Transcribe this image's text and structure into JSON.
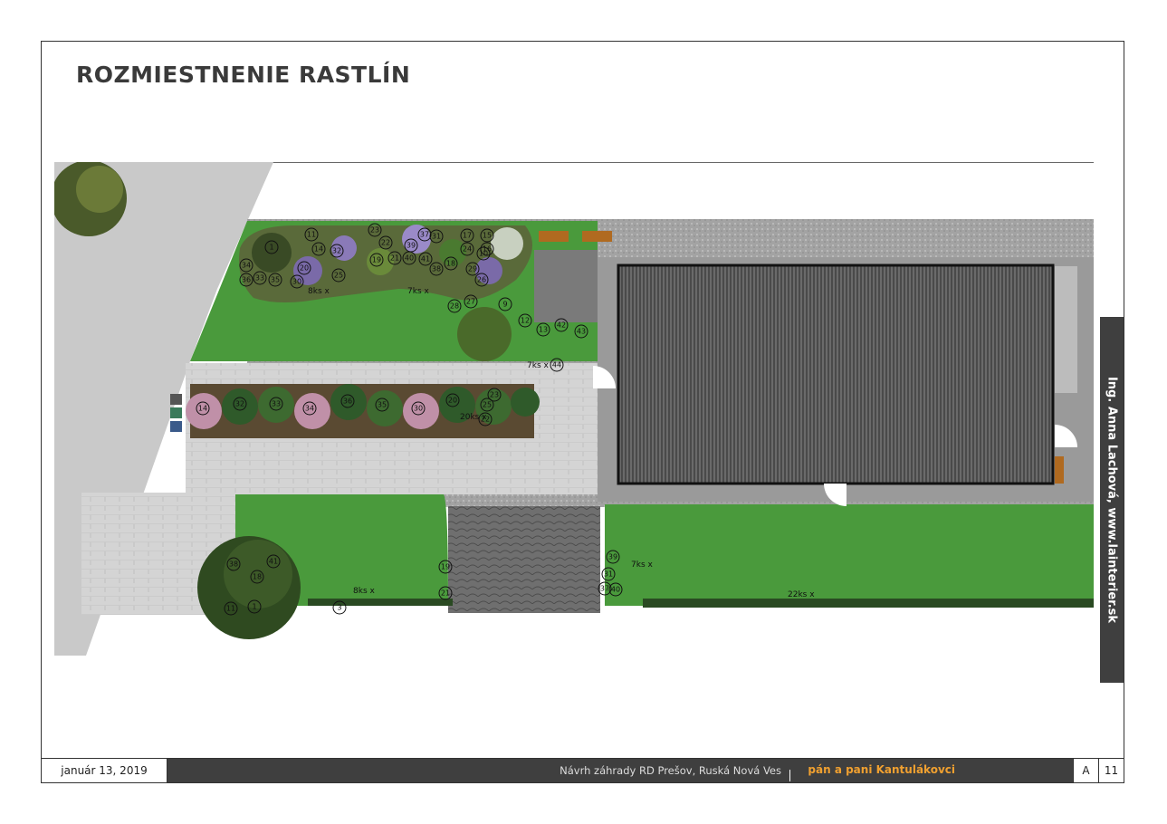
{
  "title": "ROZMIESTNENIE RASTLÍN",
  "sidebar_text": "Ing. Anna Lachová, www.lainterier.sk",
  "footer": {
    "date": "január 13, 2019",
    "project": "Návrh záhrady RD Prešov,  Ruská Nová Ves",
    "client": "pán a pani Kantulákovci",
    "sheet_letter": "A",
    "page_number": "11"
  },
  "colors": {
    "lawn": "#4a9a3c",
    "paving": "#cfcfcf",
    "roof": "#555555",
    "gravel": "#a7a7a7",
    "sidebar": "#3f3f3f",
    "client_accent": "#f0a030"
  },
  "plan": {
    "quantity_labels": [
      "8ks x",
      "7ks x",
      "7ks x",
      "20ks x",
      "8ks x",
      "7ks x",
      "22ks x"
    ],
    "plant_numbers": [
      "1",
      "11",
      "14",
      "32",
      "33",
      "34",
      "36",
      "35",
      "30",
      "20",
      "25",
      "23",
      "22",
      "21",
      "19",
      "37",
      "31",
      "39",
      "40",
      "41",
      "38",
      "18",
      "17",
      "24",
      "10",
      "15",
      "16",
      "26",
      "27",
      "28",
      "29",
      "9",
      "12",
      "13",
      "42",
      "43",
      "44",
      "3"
    ]
  }
}
